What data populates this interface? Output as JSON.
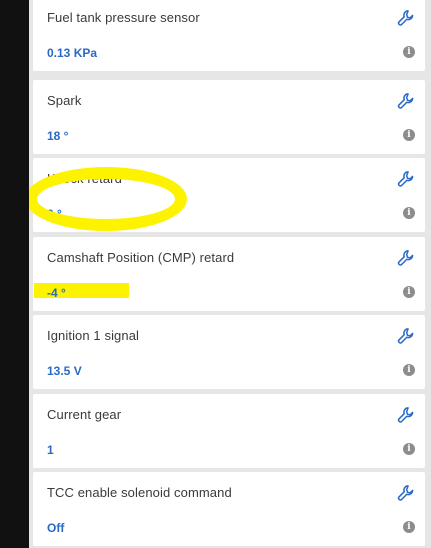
{
  "parameters": [
    {
      "name": "Fuel tank pressure sensor",
      "value": "0.13 KPa",
      "action_icon": "wrench-icon",
      "info_icon": "info-icon"
    },
    {
      "name": "Spark",
      "value": "18 °",
      "action_icon": "wrench-icon",
      "info_icon": "info-icon"
    },
    {
      "name": "Knock retard",
      "value": "0 °",
      "action_icon": "wrench-icon",
      "info_icon": "info-icon"
    },
    {
      "name": "Camshaft Position (CMP) retard",
      "value": "-4 °",
      "action_icon": "wrench-icon",
      "info_icon": "info-icon"
    },
    {
      "name": "Ignition 1 signal",
      "value": "13.5 V",
      "action_icon": "wrench-icon",
      "info_icon": "info-icon"
    },
    {
      "name": "Current gear",
      "value": "1",
      "action_icon": "wrench-icon",
      "info_icon": "info-icon"
    },
    {
      "name": "TCC enable solenoid command",
      "value": "Off",
      "action_icon": "wrench-icon",
      "info_icon": "info-icon"
    }
  ],
  "colors": {
    "value_text": "#2a69c4",
    "icon": "#2a69c4",
    "highlight": "#fdf200",
    "card_bg": "#ffffff",
    "list_bg": "#e6e6e6"
  }
}
